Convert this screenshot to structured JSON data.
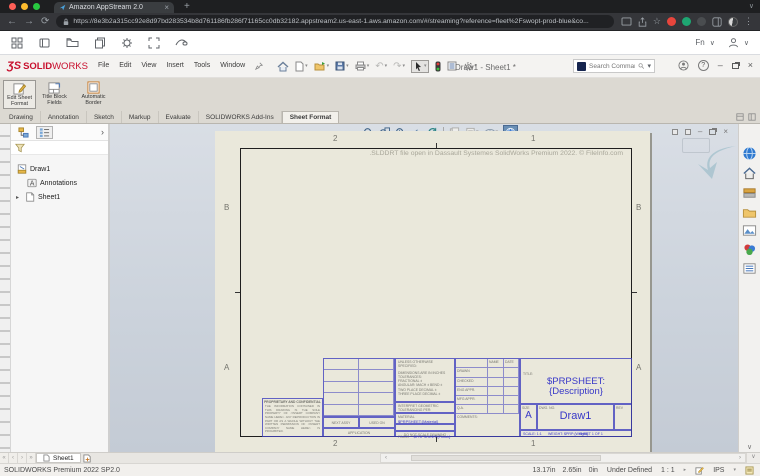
{
  "browser": {
    "tab_title": "Amazon AppStream 2.0",
    "url": "https://8e3b2a315cc92e8d97bd283534b8d761186fb286f71165cc0db32182.appstream2.us-east-1.aws.amazon.com/#/streaming?reference=fleet%2Fswopt-prod-blue&co...",
    "traffic_colors": {
      "close": "#FF5F57",
      "minimize": "#FEBC2E",
      "zoom": "#28C840"
    }
  },
  "appstream": {
    "fn_label": "Fn"
  },
  "titlebar": {
    "logo_mark": "ƷS",
    "logo_solid": "SOLID",
    "logo_works": "WORKS",
    "menus": [
      "File",
      "Edit",
      "View",
      "Insert",
      "Tools",
      "Window"
    ],
    "doc_title": "Draw1 - Sheet1 *",
    "search_placeholder": "Search Commands"
  },
  "ribbon": {
    "buttons": [
      "Edit Sheet Format",
      "Title Block Fields",
      "Automatic Border"
    ],
    "tabs": [
      "Drawing",
      "Annotation",
      "Sketch",
      "Markup",
      "Evaluate",
      "SOLIDWORKS Add-Ins",
      "Sheet Format"
    ],
    "active_tab": "Sheet Format"
  },
  "tree": {
    "root": "Draw1",
    "items": [
      "Annotations",
      "Sheet1"
    ]
  },
  "graphics": {
    "watermark": ".SLDDRT file open in Dassault Systemes SolidWorks Premium 2022. © FileInfo.com",
    "zones": {
      "col_left": "2",
      "col_right": "1",
      "row_top": "B",
      "row_bottom": "A"
    }
  },
  "titleblock": {
    "unless": "UNLESS OTHERWISE SPECIFIED:",
    "tol": [
      "DIMENSIONS ARE IN INCHES",
      "TOLERANCES:",
      "FRACTIONAL ±",
      "ANGULAR: MACH ±  BEND ±",
      "TWO PLACE DECIMAL    ±",
      "THREE PLACE DECIMAL  ±"
    ],
    "interpret": "INTERPRET GEOMETRIC TOLERANCING PER:",
    "material_label": "MATERIAL",
    "material_value": "$PRPSHEET:{Material}",
    "finish_label": "FINISH",
    "finish_value": "$PRPSHEET:{Finish}",
    "name_header": "NAME",
    "date_header": "DATE",
    "rows": [
      "DRAWN",
      "CHECKED",
      "ENG APPR.",
      "MFG APPR.",
      "Q.A.",
      "COMMENTS:"
    ],
    "proprietary_title": "PROPRIETARY AND CONFIDENTIAL",
    "proprietary_body": "THE INFORMATION CONTAINED IN THIS DRAWING IS THE SOLE PROPERTY OF <INSERT COMPANY NAME HERE>. ANY REPRODUCTION IN PART OR AS A WHOLE WITHOUT THE WRITTEN PERMISSION OF <INSERT COMPANY NAME HERE> IS PROHIBITED.",
    "next_assy": "NEXT ASSY",
    "used_on": "USED ON",
    "application": "APPLICATION",
    "do_not_scale": "DO NOT SCALE DRAWING",
    "title_label": "TITLE:",
    "title_value": "$PRPSHEET:{Description}",
    "size_label": "SIZE",
    "size_value": "A",
    "dwg_label": "DWG.  NO.",
    "dwg_value": "Draw1",
    "rev_label": "REV",
    "scale": "SCALE: 1:1",
    "weight": "WEIGHT: $PRP:{Weight}",
    "sheet": "SHEET 1 OF 1"
  },
  "sheetbar": {
    "tab": "Sheet1",
    "nav": [
      "«",
      "‹",
      "›",
      "»"
    ]
  },
  "statusbar": {
    "app": "SOLIDWORKS Premium 2022 SP2.0",
    "x": "13.17in",
    "y": "2.65in",
    "z": "0in",
    "state": "Under Defined",
    "scale": "1 : 1",
    "units": "IPS"
  },
  "glyphs": {
    "chevron_down": "▾",
    "chevron_small": "∨",
    "panel_collapse": "›",
    "close": "×",
    "plus": "+",
    "minimize": "–",
    "back": "←",
    "forward": "→",
    "reload": "⟳",
    "menu_dots": "⋮",
    "star": "☆",
    "undo": "↶",
    "redo": "↷",
    "expander": "▸",
    "question": "?",
    "scroll_left": "‹",
    "scroll_right": "›",
    "scroll_down": "∨"
  }
}
